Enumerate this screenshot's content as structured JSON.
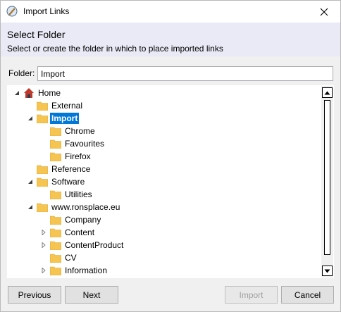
{
  "window": {
    "title": "Import Links"
  },
  "header": {
    "title": "Select Folder",
    "subtitle": "Select or create the folder in which to place imported links"
  },
  "folder": {
    "label": "Folder:",
    "value": "Import"
  },
  "tree": {
    "nodes": [
      {
        "label": "Home",
        "icon": "home-icon",
        "expander": "expanded",
        "selected": false
      },
      {
        "label": "External",
        "icon": "folder-icon",
        "expander": "none",
        "selected": false
      },
      {
        "label": "Import",
        "icon": "folder-icon",
        "expander": "expanded",
        "selected": true
      },
      {
        "label": "Chrome",
        "icon": "folder-icon",
        "expander": "none",
        "selected": false
      },
      {
        "label": "Favourites",
        "icon": "folder-icon",
        "expander": "none",
        "selected": false
      },
      {
        "label": "Firefox",
        "icon": "folder-icon",
        "expander": "none",
        "selected": false
      },
      {
        "label": "Reference",
        "icon": "folder-icon",
        "expander": "none",
        "selected": false
      },
      {
        "label": "Software",
        "icon": "folder-icon",
        "expander": "expanded",
        "selected": false
      },
      {
        "label": "Utilities",
        "icon": "folder-icon",
        "expander": "none",
        "selected": false
      },
      {
        "label": "www.ronsplace.eu",
        "icon": "folder-icon",
        "expander": "expanded",
        "selected": false
      },
      {
        "label": "Company",
        "icon": "folder-icon",
        "expander": "none",
        "selected": false
      },
      {
        "label": "Content",
        "icon": "folder-icon",
        "expander": "collapsed",
        "selected": false
      },
      {
        "label": "ContentProduct",
        "icon": "folder-icon",
        "expander": "collapsed",
        "selected": false
      },
      {
        "label": "CV",
        "icon": "folder-icon",
        "expander": "none",
        "selected": false
      },
      {
        "label": "Information",
        "icon": "folder-icon",
        "expander": "collapsed",
        "selected": false
      }
    ]
  },
  "buttons": {
    "previous": "Previous",
    "next": "Next",
    "import": "Import",
    "cancel": "Cancel"
  },
  "colors": {
    "header_bg": "#e9eaf5",
    "selection": "#0078d7",
    "folder": "#f5c451"
  }
}
